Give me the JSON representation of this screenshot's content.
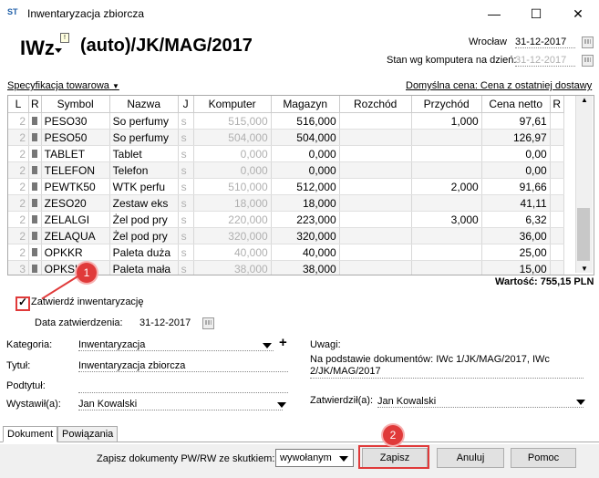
{
  "window": {
    "title": "Inwentaryzacja zbiorcza",
    "app_icon_text": "ST"
  },
  "header": {
    "doc_type": "IWz",
    "doc_flag": "!",
    "doc_number": "(auto)/JK/MAG/2017",
    "city": "Wrocław",
    "date": "31-12-2017",
    "stock_label": "Stan wg komputera na dzień:",
    "stock_date": "31-12-2017"
  },
  "spec": {
    "label": "Specyfikacja towarowa",
    "price_label": "Domyślna cena: Cena z ostatniej dostawy"
  },
  "table": {
    "headers": [
      "L",
      "R",
      "Symbol",
      "Nazwa",
      "J",
      "Komputer",
      "Magazyn",
      "Rozchód",
      "Przychód",
      "Cena netto",
      "R"
    ],
    "rows": [
      {
        "l": "2",
        "sym": "PESO30",
        "name": "So perfumy",
        "j": "s",
        "komp": "515,000",
        "mag": "516,000",
        "roz": "",
        "prz": "1,000",
        "cena": "97,61"
      },
      {
        "l": "2",
        "sym": "PESO50",
        "name": "So perfumy",
        "j": "s",
        "komp": "504,000",
        "mag": "504,000",
        "roz": "",
        "prz": "",
        "cena": "126,97"
      },
      {
        "l": "2",
        "sym": "TABLET",
        "name": "Tablet",
        "j": "s",
        "komp": "0,000",
        "mag": "0,000",
        "roz": "",
        "prz": "",
        "cena": "0,00"
      },
      {
        "l": "2",
        "sym": "TELEFON",
        "name": "Telefon",
        "j": "s",
        "komp": "0,000",
        "mag": "0,000",
        "roz": "",
        "prz": "",
        "cena": "0,00"
      },
      {
        "l": "2",
        "sym": "PEWTK50",
        "name": "WTK perfu",
        "j": "s",
        "komp": "510,000",
        "mag": "512,000",
        "roz": "",
        "prz": "2,000",
        "cena": "91,66"
      },
      {
        "l": "2",
        "sym": "ZESO20",
        "name": "Zestaw eks",
        "j": "s",
        "komp": "18,000",
        "mag": "18,000",
        "roz": "",
        "prz": "",
        "cena": "41,11"
      },
      {
        "l": "2",
        "sym": "ZELALGI",
        "name": "Żel pod pry",
        "j": "s",
        "komp": "220,000",
        "mag": "223,000",
        "roz": "",
        "prz": "3,000",
        "cena": "6,32"
      },
      {
        "l": "2",
        "sym": "ZELAQUA",
        "name": "Żel pod pry",
        "j": "s",
        "komp": "320,000",
        "mag": "320,000",
        "roz": "",
        "prz": "",
        "cena": "36,00"
      },
      {
        "l": "2",
        "sym": "OPKKR",
        "name": "Paleta duża",
        "j": "s",
        "komp": "40,000",
        "mag": "40,000",
        "roz": "",
        "prz": "",
        "cena": "25,00"
      },
      {
        "l": "3",
        "sym": "OPKSK",
        "name": "Paleta mała",
        "j": "s",
        "komp": "38,000",
        "mag": "38,000",
        "roz": "",
        "prz": "",
        "cena": "15,00"
      }
    ]
  },
  "value_label": "Wartość: 755,15 PLN",
  "approve": {
    "label": "Zatwierdź inwentaryzację",
    "checked": true,
    "date_label": "Data zatwierdzenia:",
    "date": "31-12-2017"
  },
  "form": {
    "category_label": "Kategoria:",
    "category": "Inwentaryzacja",
    "title_label": "Tytuł:",
    "title": "Inwentaryzacja zbiorcza",
    "subtitle_label": "Podtytuł:",
    "issuer_label": "Wystawił(a):",
    "issuer": "Jan Kowalski",
    "notes_label": "Uwagi:",
    "notes": "Na podstawie dokumentów: IWc 1/JK/MAG/2017, IWc 2/JK/MAG/2017",
    "approver_label": "Zatwierdził(a):",
    "approver": "Jan Kowalski"
  },
  "tabs": [
    "Dokument",
    "Powiązania"
  ],
  "footer": {
    "save_docs_label": "Zapisz dokumenty PW/RW ze skutkiem:",
    "mode": "wywołanym",
    "save": "Zapisz",
    "cancel": "Anuluj",
    "help": "Pomoc"
  },
  "annotations": [
    "1",
    "2"
  ],
  "colors": {
    "accent": "#e03a3a"
  }
}
